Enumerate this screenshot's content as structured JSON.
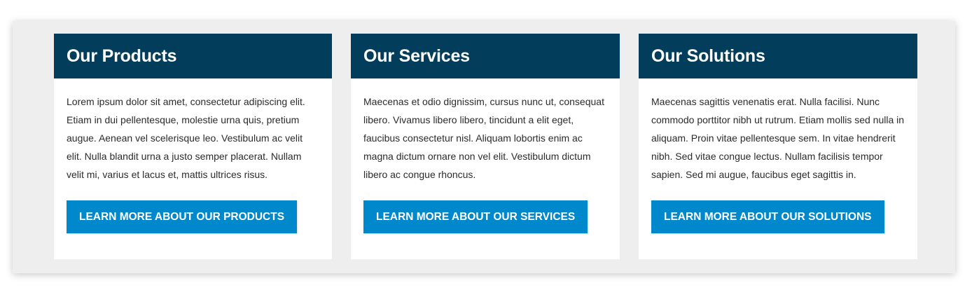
{
  "cards": [
    {
      "title": "Our Products",
      "text": "Lorem ipsum dolor sit amet, consectetur adipiscing elit. Etiam in dui pellentesque, molestie urna quis, pretium augue. Aenean vel scelerisque leo. Vestibulum ac velit elit. Nulla blandit urna a justo semper placerat. Nullam velit mi, varius et lacus et, mattis ultrices risus.",
      "button_label": "Learn more about our Products"
    },
    {
      "title": "Our Services",
      "text": "Maecenas et odio dignissim, cursus nunc ut, consequat libero. Vivamus libero libero, tincidunt a elit eget, faucibus consectetur nisl. Aliquam lobortis enim ac magna dictum ornare non vel elit. Vestibulum dictum libero ac congue rhoncus.",
      "button_label": "Learn more about our Services"
    },
    {
      "title": "Our Solutions",
      "text": "Maecenas sagittis venenatis erat. Nulla facilisi. Nunc commodo porttitor nibh ut rutrum. Etiam mollis sed nulla in aliquam. Proin vitae pellentesque sem. In vitae hendrerit nibh. Sed vitae congue lectus. Nullam facilisis tempor sapien. Sed mi augue, faucibus eget sagittis in.",
      "button_label": "Learn more about our Solutions"
    }
  ],
  "colors": {
    "header_bg": "#023d5b",
    "button_bg": "#0088cc",
    "panel_bg": "#eeeeee"
  }
}
